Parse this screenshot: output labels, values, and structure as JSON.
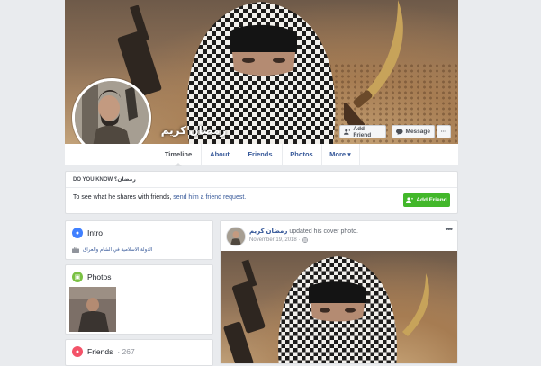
{
  "profile": {
    "name": "رمضان كريم"
  },
  "cover_buttons": {
    "add_friend": "Add Friend",
    "message": "Message",
    "more": "···"
  },
  "tabs": [
    {
      "label": "Timeline"
    },
    {
      "label": "About"
    },
    {
      "label": "Friends"
    },
    {
      "label": "Photos"
    },
    {
      "label": "More ▾"
    }
  ],
  "do_you_know": {
    "heading": "DO YOU KNOW رمضان؟",
    "text": "To see what he shares with friends,",
    "link": "send him a friend request.",
    "button": "Add Friend"
  },
  "intro": {
    "title": "Intro",
    "item": "الدولة الاسلامية في الشام والعراق"
  },
  "photos": {
    "title": "Photos"
  },
  "friends": {
    "title": "Friends",
    "count": "· 267"
  },
  "post": {
    "author": "رمضان كريم",
    "action": "updated his cover photo.",
    "date": "November 19, 2018 ·",
    "menu": "•••"
  },
  "colors": {
    "link": "#365899",
    "green_button": "#42b72a",
    "page_bg": "#e9ebee",
    "intro_icon": "#4080ff",
    "photos_icon": "#7ac143",
    "friends_icon": "#f35369"
  }
}
